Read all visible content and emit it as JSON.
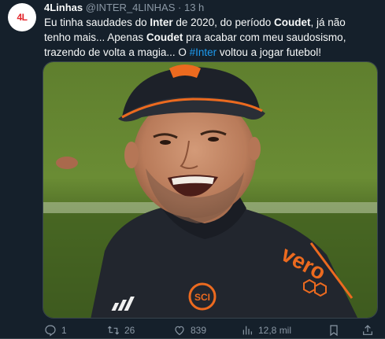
{
  "tweet": {
    "avatar_text": "4L",
    "author_name": "4Linhas",
    "handle": "@INTER_4LINHAS",
    "separator": "·",
    "time": "13 h",
    "text": {
      "p1": "Eu tinha saudades do ",
      "b1": "Inter",
      "p2": " de 2020, do período ",
      "b2": "Coudet",
      "p3": ", já não tenho mais... Apenas ",
      "b3": "Coudet",
      "p4": " pra acabar com meu saudosismo, trazendo de volta a magia... O ",
      "hashtag": "#Inter",
      "p5": " voltou a jogar futebol!"
    },
    "media": {
      "jacket_text": "vero",
      "sponsor_icon": "hexagon-honeycomb-icon",
      "crest_text": "SCI"
    },
    "actions": {
      "replies": "1",
      "retweets": "26",
      "likes": "839",
      "views": "12,8 mil"
    }
  },
  "colors": {
    "background": "#15202b",
    "text": "#f7f9f9",
    "muted": "#8b98a5",
    "link": "#1d9bf0",
    "orange": "#ec6a1f"
  }
}
